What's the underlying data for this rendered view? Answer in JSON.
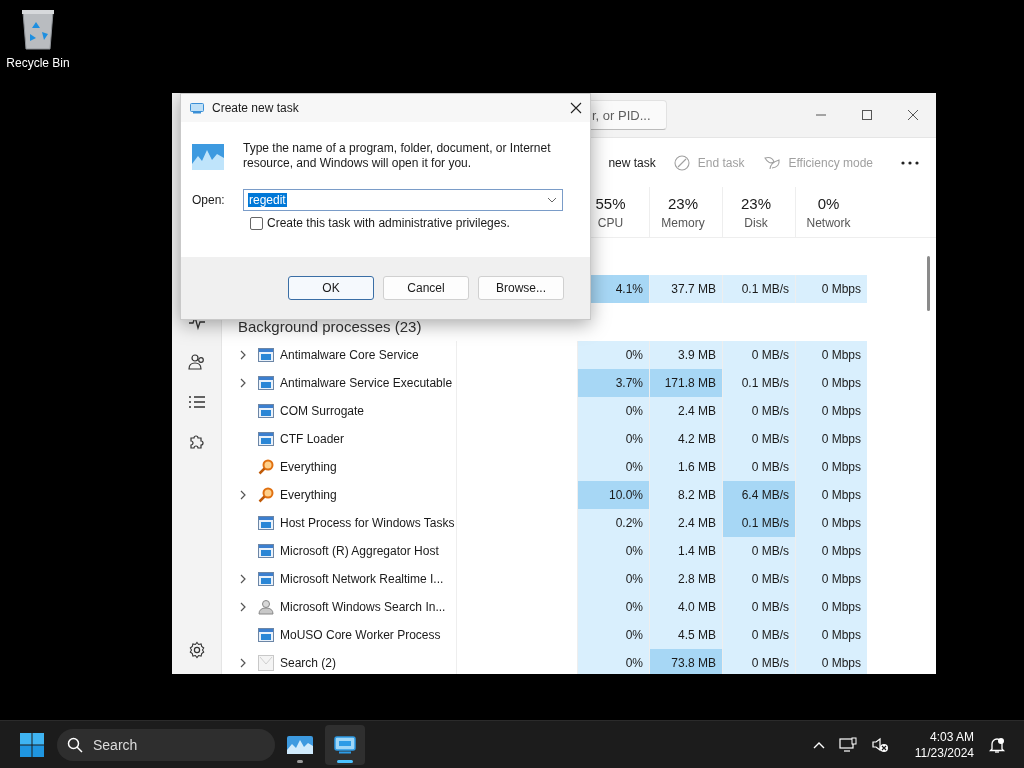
{
  "desktop": {
    "icons": [
      {
        "label": "Recycle Bin"
      }
    ]
  },
  "task_manager": {
    "search": {
      "placeholder": "r, or PID..."
    },
    "toolbar": [
      {
        "kind": "run",
        "label": "new task",
        "disabled": false
      },
      {
        "kind": "end",
        "label": "End task",
        "disabled": true
      },
      {
        "kind": "efficiency",
        "label": "Efficiency mode",
        "disabled": true
      }
    ],
    "columns": [
      {
        "percent": "55%",
        "label": "CPU"
      },
      {
        "percent": "23%",
        "label": "Memory"
      },
      {
        "percent": "23%",
        "label": "Disk"
      },
      {
        "percent": "0%",
        "label": "Network"
      }
    ],
    "app_rows": [
      {
        "cells": [
          {
            "text": "4.1%",
            "hot": true
          },
          {
            "text": "37.7 MB",
            "hot": false
          },
          {
            "text": "0.1 MB/s",
            "hot": false
          },
          {
            "text": "0 Mbps",
            "hot": false
          }
        ]
      }
    ],
    "group": {
      "label": "Background processes (23)"
    },
    "rows": [
      {
        "name": "Antimalware Core Service",
        "expandable": true,
        "kind": "window",
        "cells": [
          {
            "text": "0%",
            "hot": false
          },
          {
            "text": "3.9 MB",
            "hot": false
          },
          {
            "text": "0 MB/s",
            "hot": false
          },
          {
            "text": "0 Mbps",
            "hot": false
          }
        ]
      },
      {
        "name": "Antimalware Service Executable",
        "expandable": true,
        "kind": "window",
        "cells": [
          {
            "text": "3.7%",
            "hot": true
          },
          {
            "text": "171.8 MB",
            "hot": true
          },
          {
            "text": "0.1 MB/s",
            "hot": false
          },
          {
            "text": "0 Mbps",
            "hot": false
          }
        ]
      },
      {
        "name": "COM Surrogate",
        "expandable": false,
        "kind": "window",
        "cells": [
          {
            "text": "0%",
            "hot": false
          },
          {
            "text": "2.4 MB",
            "hot": false
          },
          {
            "text": "0 MB/s",
            "hot": false
          },
          {
            "text": "0 Mbps",
            "hot": false
          }
        ]
      },
      {
        "name": "CTF Loader",
        "expandable": false,
        "kind": "window",
        "cells": [
          {
            "text": "0%",
            "hot": false
          },
          {
            "text": "4.2 MB",
            "hot": false
          },
          {
            "text": "0 MB/s",
            "hot": false
          },
          {
            "text": "0 Mbps",
            "hot": false
          }
        ]
      },
      {
        "name": "Everything",
        "expandable": false,
        "kind": "magnifier",
        "cells": [
          {
            "text": "0%",
            "hot": false
          },
          {
            "text": "1.6 MB",
            "hot": false
          },
          {
            "text": "0 MB/s",
            "hot": false
          },
          {
            "text": "0 Mbps",
            "hot": false
          }
        ]
      },
      {
        "name": "Everything",
        "expandable": true,
        "kind": "magnifier",
        "cells": [
          {
            "text": "10.0%",
            "hot": true
          },
          {
            "text": "8.2 MB",
            "hot": false
          },
          {
            "text": "6.4 MB/s",
            "hot": true
          },
          {
            "text": "0 Mbps",
            "hot": false
          }
        ]
      },
      {
        "name": "Host Process for Windows Tasks",
        "expandable": false,
        "kind": "window",
        "cells": [
          {
            "text": "0.2%",
            "hot": false
          },
          {
            "text": "2.4 MB",
            "hot": false
          },
          {
            "text": "0.1 MB/s",
            "hot": true
          },
          {
            "text": "0 Mbps",
            "hot": false
          }
        ]
      },
      {
        "name": "Microsoft (R) Aggregator Host",
        "expandable": false,
        "kind": "window",
        "cells": [
          {
            "text": "0%",
            "hot": false
          },
          {
            "text": "1.4 MB",
            "hot": false
          },
          {
            "text": "0 MB/s",
            "hot": false
          },
          {
            "text": "0 Mbps",
            "hot": false
          }
        ]
      },
      {
        "name": "Microsoft Network Realtime I...",
        "expandable": true,
        "kind": "window",
        "cells": [
          {
            "text": "0%",
            "hot": false
          },
          {
            "text": "2.8 MB",
            "hot": false
          },
          {
            "text": "0 MB/s",
            "hot": false
          },
          {
            "text": "0 Mbps",
            "hot": false
          }
        ]
      },
      {
        "name": "Microsoft Windows Search In...",
        "expandable": true,
        "kind": "person",
        "cells": [
          {
            "text": "0%",
            "hot": false
          },
          {
            "text": "4.0 MB",
            "hot": false
          },
          {
            "text": "0 MB/s",
            "hot": false
          },
          {
            "text": "0 Mbps",
            "hot": false
          }
        ]
      },
      {
        "name": "MoUSO Core Worker Process",
        "expandable": false,
        "kind": "window",
        "cells": [
          {
            "text": "0%",
            "hot": false
          },
          {
            "text": "4.5 MB",
            "hot": false
          },
          {
            "text": "0 MB/s",
            "hot": false
          },
          {
            "text": "0 Mbps",
            "hot": false
          }
        ]
      },
      {
        "name": "Search (2)",
        "expandable": true,
        "kind": "blank",
        "cells": [
          {
            "text": "0%",
            "hot": false
          },
          {
            "text": "73.8 MB",
            "hot": true
          },
          {
            "text": "0 MB/s",
            "hot": false
          },
          {
            "text": "0 Mbps",
            "hot": false
          }
        ]
      }
    ]
  },
  "dialog": {
    "title": "Create new task",
    "message": "Type the name of a program, folder, document, or Internet resource, and Windows will open it for you.",
    "open_label": "Open:",
    "open_field": {
      "value": "regedit",
      "selected": true
    },
    "admin_checkbox": {
      "label": "Create this task with administrative privileges.",
      "checked": false
    },
    "buttons": [
      {
        "label": "OK",
        "default": true
      },
      {
        "label": "Cancel",
        "default": false
      },
      {
        "label": "Browse...",
        "default": false
      }
    ]
  },
  "taskbar": {
    "search": {
      "placeholder": "Search"
    },
    "apps": [
      {
        "kind": "monitor",
        "active": false
      },
      {
        "kind": "run",
        "active": true
      }
    ],
    "time": "4:03 AM",
    "date": "11/23/2024"
  }
}
